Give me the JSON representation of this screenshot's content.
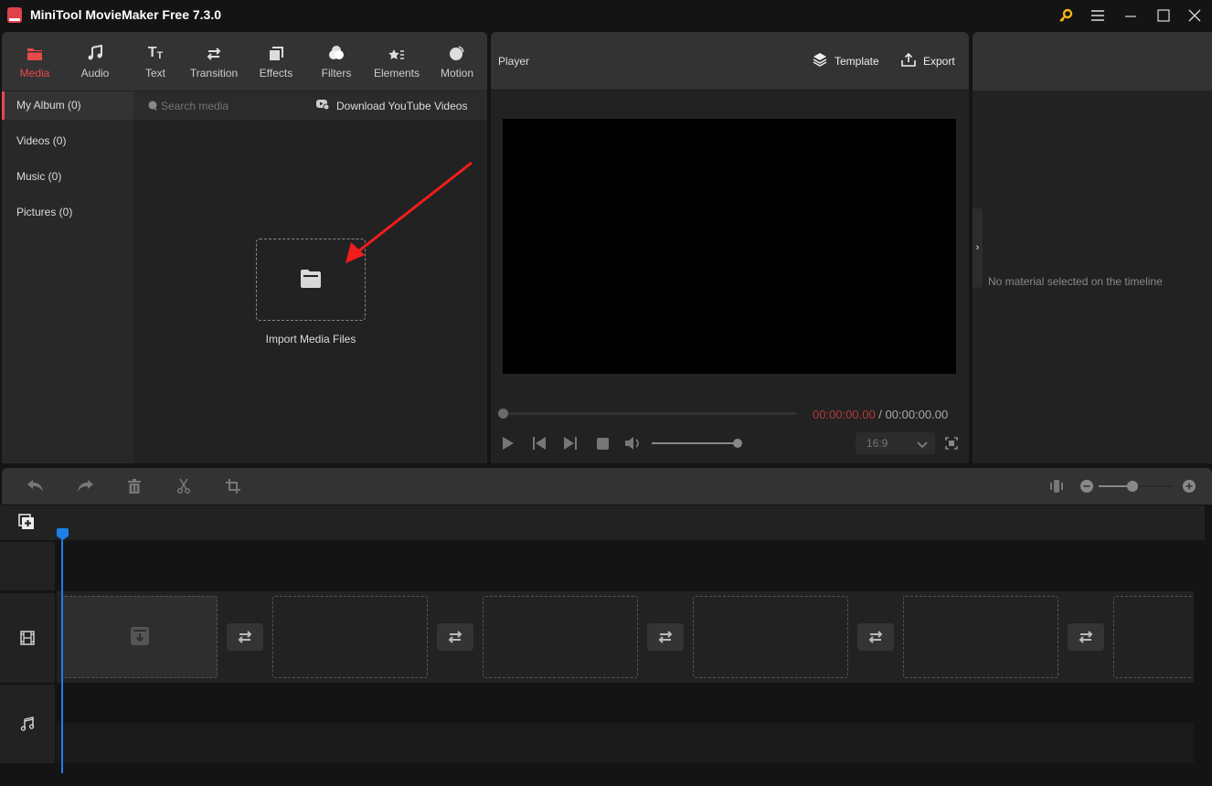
{
  "window": {
    "title": "MiniTool MovieMaker Free 7.3.0",
    "icons": [
      "key-icon",
      "menu-icon",
      "minimize-icon",
      "maximize-icon",
      "close-icon"
    ]
  },
  "media_tabs": [
    {
      "label": "Media",
      "icon": "folder-icon",
      "active": true
    },
    {
      "label": "Audio",
      "icon": "music-note-icon",
      "active": false
    },
    {
      "label": "Text",
      "icon": "text-icon",
      "active": false
    },
    {
      "label": "Transition",
      "icon": "swap-arrows-icon",
      "active": false
    },
    {
      "label": "Effects",
      "icon": "effects-icon",
      "active": false
    },
    {
      "label": "Filters",
      "icon": "filters-icon",
      "active": false
    },
    {
      "label": "Elements",
      "icon": "elements-icon",
      "active": false
    },
    {
      "label": "Motion",
      "icon": "motion-icon",
      "active": false
    }
  ],
  "album": {
    "items": [
      {
        "label": "My Album (0)",
        "active": true
      },
      {
        "label": "Videos (0)",
        "active": false
      },
      {
        "label": "Music (0)",
        "active": false
      },
      {
        "label": "Pictures (0)",
        "active": false
      }
    ]
  },
  "search": {
    "placeholder": "Search media"
  },
  "download_youtube": {
    "label": "Download YouTube Videos"
  },
  "import": {
    "label": "Import Media Files"
  },
  "player": {
    "title": "Player",
    "template_label": "Template",
    "export_label": "Export",
    "current_time": "00:00:00.00",
    "separator": " / ",
    "total_time": "00:00:00.00",
    "progress": 0,
    "volume": 1.0,
    "aspect_ratio": "16:9"
  },
  "properties": {
    "empty_message": "No material selected on the timeline"
  },
  "timeline": {
    "zoom_level": 0.45,
    "slot_count": 6,
    "transition_count": 5
  },
  "colors": {
    "accent": "#e84a4a",
    "playhead": "#1e7fe6",
    "time_current": "#b03a36",
    "key": "#f5b614"
  }
}
